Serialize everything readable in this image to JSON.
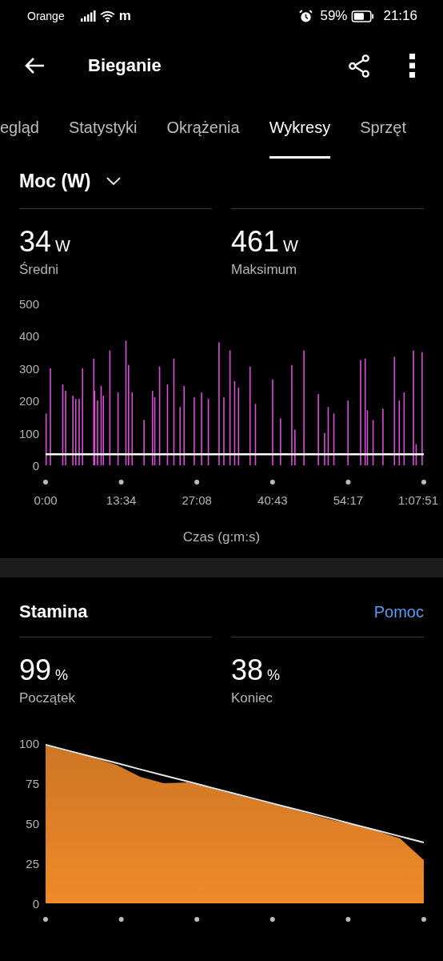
{
  "status_bar": {
    "carrier": "Orange",
    "network_badge": "m",
    "battery_percent": "59%",
    "time": "21:16"
  },
  "header": {
    "title": "Bieganie"
  },
  "tabs": [
    {
      "label": "egląd",
      "selected": false
    },
    {
      "label": "Statystyki",
      "selected": false
    },
    {
      "label": "Okrążenia",
      "selected": false
    },
    {
      "label": "Wykresy",
      "selected": true
    },
    {
      "label": "Sprzęt",
      "selected": false
    }
  ],
  "power": {
    "metric_selector": "Moc (W)",
    "stats": [
      {
        "value": "34",
        "unit": "W",
        "label": "Średni"
      },
      {
        "value": "461",
        "unit": "W",
        "label": "Maksimum"
      }
    ],
    "chart_data": {
      "type": "bar",
      "xlabel": "Czas (g:m:s)",
      "xlim": [
        0,
        4071
      ],
      "ylim": [
        0,
        500
      ],
      "yticks": [
        0,
        100,
        200,
        300,
        400,
        500
      ],
      "xticks": [
        {
          "value": 0,
          "label": "0:00"
        },
        {
          "value": 814,
          "label": "13:34"
        },
        {
          "value": 1628,
          "label": "27:08"
        },
        {
          "value": 2443,
          "label": "40:43"
        },
        {
          "value": 3257,
          "label": "54:17"
        },
        {
          "value": 4071,
          "label": "1:07:51"
        }
      ],
      "x": [
        6,
        52,
        185,
        216,
        294,
        325,
        361,
        398,
        519,
        528,
        559,
        598,
        622,
        692,
        780,
        865,
        893,
        932,
        1060,
        1151,
        1175,
        1227,
        1312,
        1381,
        1448,
        1491,
        1600,
        1679,
        1752,
        1867,
        1919,
        1985,
        2035,
        2077,
        2201,
        2259,
        2444,
        2529,
        2650,
        2684,
        2781,
        2936,
        3003,
        3042,
        3103,
        3255,
        3391,
        3440,
        3464,
        3525,
        3631,
        3755,
        3807,
        3859,
        3959,
        3989,
        4053
      ],
      "series": [
        {
          "color": "#d94fd6",
          "values": [
            160,
            300,
            250,
            230,
            215,
            205,
            205,
            300,
            330,
            230,
            200,
            245,
            215,
            355,
            225,
            385,
            310,
            225,
            140,
            230,
            210,
            305,
            250,
            330,
            180,
            245,
            210,
            225,
            205,
            380,
            210,
            355,
            260,
            240,
            305,
            190,
            265,
            145,
            310,
            110,
            355,
            220,
            100,
            180,
            160,
            200,
            325,
            330,
            170,
            140,
            175,
            335,
            200,
            225,
            355,
            65,
            350
          ]
        }
      ],
      "ref_lines": [
        {
          "axis": "y",
          "value": 34
        }
      ]
    }
  },
  "stamina": {
    "title": "Stamina",
    "help_link": "Pomoc",
    "stats": [
      {
        "value": "99",
        "unit": "%",
        "label": "Początek"
      },
      {
        "value": "38",
        "unit": "%",
        "label": "Koniec"
      }
    ],
    "chart_data": {
      "type": "area",
      "ylim": [
        0,
        100
      ],
      "yticks": [
        0,
        25,
        50,
        75,
        100
      ],
      "series": [
        {
          "color": "#f08a2a",
          "values": [
            98.5,
            94.8,
            91,
            86.5,
            79,
            75,
            75.5,
            72,
            68,
            64.3,
            60.5,
            56.5,
            52.5,
            49,
            45.3,
            40.5,
            27
          ]
        },
        {
          "type": "line",
          "color": "#e6e6e6",
          "values": [
            99,
            95.2,
            91.4,
            87.6,
            83.7,
            79.9,
            76.1,
            72.3,
            68.5,
            64.7,
            60.9,
            57.1,
            53.3,
            49.4,
            45.6,
            41.8,
            38
          ]
        }
      ]
    }
  }
}
